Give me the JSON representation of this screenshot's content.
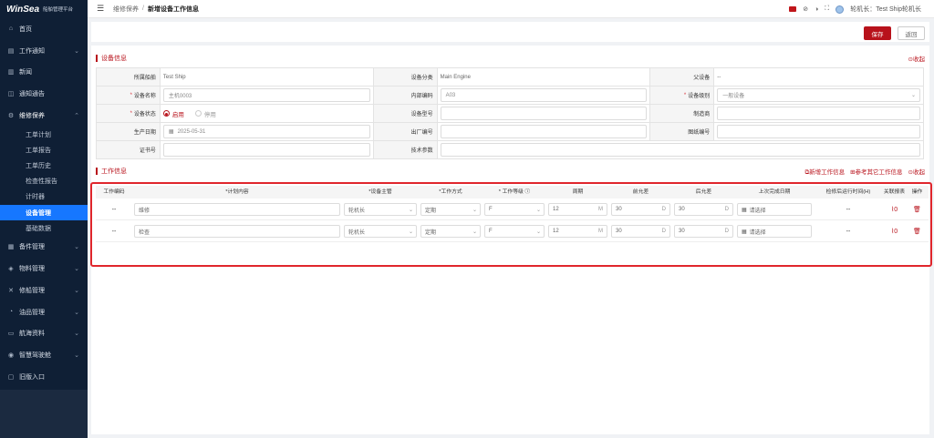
{
  "brand": {
    "name": "WinSea",
    "sub": "船舶管理平台"
  },
  "menu": [
    {
      "label": "首页",
      "icon": "⌂"
    },
    {
      "label": "工作通知",
      "icon": "▤",
      "chevron": true
    },
    {
      "label": "新闻",
      "icon": "▥"
    },
    {
      "label": "通知通告",
      "icon": "◫"
    },
    {
      "label": "维修保养",
      "icon": "⚙",
      "chevron": true,
      "open": true
    }
  ],
  "submenu": [
    {
      "label": "工单计划"
    },
    {
      "label": "工单报告"
    },
    {
      "label": "工单历史"
    },
    {
      "label": "检查性报告"
    },
    {
      "label": "计时器"
    },
    {
      "label": "设备管理",
      "active": true
    },
    {
      "label": "基础数据"
    }
  ],
  "menu2": [
    {
      "label": "备件管理",
      "icon": "▦"
    },
    {
      "label": "物料管理",
      "icon": "◈"
    },
    {
      "label": "修船管理",
      "icon": "✕"
    },
    {
      "label": "油品管理",
      "icon": "◔"
    },
    {
      "label": "航海资料",
      "icon": "▭"
    },
    {
      "label": "智慧驾驶舱",
      "icon": "◉"
    },
    {
      "label": "旧版入口",
      "icon": "▢",
      "nochev": true
    }
  ],
  "breadcrumb": {
    "b1": "维修保养",
    "sep": "/",
    "b2": "新增设备工作信息"
  },
  "topbar": {
    "user": "轮机长：Test Ship轮机长"
  },
  "buttons": {
    "save": "保存",
    "back": "返回"
  },
  "equip": {
    "title": "设备信息",
    "collapse": "⊙收起",
    "labels": {
      "ship": "所属船舶",
      "category": "设备分类",
      "parent": "父设备",
      "name": "设备名称",
      "code": "内部编码",
      "level": "设备级别",
      "status": "设备状态",
      "model": "设备型号",
      "maker": "制造商",
      "date": "生产日期",
      "serial": "出厂编号",
      "drawing": "图纸编号",
      "cert": "证书号",
      "params": "技术参数"
    },
    "values": {
      "ship": "Test Ship",
      "category": "Main Engine",
      "parent": "--",
      "name": "主机0003",
      "code": "A03",
      "level": "一般设备",
      "status_on": "启用",
      "status_off": "停用",
      "date": "2025-05-31"
    }
  },
  "work": {
    "title": "工作信息",
    "add": "新增工作信息",
    "ref": "参考其它工作信息",
    "collapse": "⊙收起",
    "headers": {
      "code": "工作编码",
      "content": "*计划内容",
      "role": "*设备主管",
      "mode": "*工作方式",
      "grade": "* 工作等级 ⓘ",
      "cycle": "周期",
      "before": "前允差",
      "after": "后允差",
      "last": "上次完成日期",
      "runtime": "检修后运行时间(H)",
      "link": "关联报表",
      "op": "操作"
    },
    "rows": [
      {
        "code": "--",
        "content": "维修",
        "role": "轮机长",
        "mode": "定期",
        "grade": "F",
        "cycle": "12",
        "cunit": "M",
        "before": "30",
        "bunit": "D",
        "after": "30",
        "aunit": "D",
        "last": "请选择",
        "runtime": "--",
        "link": "0"
      },
      {
        "code": "--",
        "content": "检查",
        "role": "轮机长",
        "mode": "定期",
        "grade": "F",
        "cycle": "12",
        "cunit": "M",
        "before": "30",
        "bunit": "D",
        "after": "30",
        "aunit": "D",
        "last": "请选择",
        "runtime": "--",
        "link": "0"
      }
    ]
  }
}
